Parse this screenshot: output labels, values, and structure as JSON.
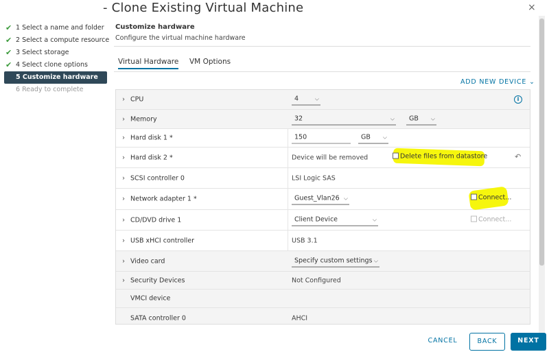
{
  "window": {
    "title": "- Clone Existing Virtual Machine",
    "close_glyph": "×"
  },
  "steps": [
    {
      "label": "1 Select a name and folder",
      "done": true
    },
    {
      "label": "2 Select a compute resource",
      "done": true
    },
    {
      "label": "3 Select storage",
      "done": true
    },
    {
      "label": "4 Select clone options",
      "done": true
    },
    {
      "label": "5 Customize hardware",
      "active": true
    },
    {
      "label": "6 Ready to complete",
      "future": true
    }
  ],
  "header": {
    "title": "Customize hardware",
    "subtitle": "Configure the virtual machine hardware"
  },
  "tabs": [
    {
      "label": "Virtual Hardware",
      "active": true
    },
    {
      "label": "VM Options",
      "active": false
    }
  ],
  "add_device": "ADD NEW DEVICE",
  "hardware": {
    "cpu": {
      "label": "CPU",
      "value": "4"
    },
    "memory": {
      "label": "Memory",
      "value": "32",
      "unit": "GB"
    },
    "hard_disk_1": {
      "label": "Hard disk 1 *",
      "value": "150",
      "unit": "GB"
    },
    "hard_disk_2": {
      "label": "Hard disk 2 *",
      "status": "Device will be removed",
      "checkbox_label": "Delete files from datastore"
    },
    "scsi": {
      "label": "SCSI controller 0",
      "value": "LSI Logic SAS"
    },
    "network": {
      "label": "Network adapter 1 *",
      "value": "Guest_Vlan26",
      "checkbox_label": "Connect..."
    },
    "cd_dvd": {
      "label": "CD/DVD drive 1",
      "value": "Client Device",
      "checkbox_label": "Connect..."
    },
    "usb": {
      "label": "USB xHCI controller",
      "value": "USB 3.1"
    },
    "video": {
      "label": "Video card",
      "value": "Specify custom settings"
    },
    "security": {
      "label": "Security Devices",
      "value": "Not Configured"
    },
    "vmci": {
      "label": "VMCI device"
    },
    "sata": {
      "label": "SATA controller 0",
      "value": "AHCI"
    }
  },
  "colors": {
    "accent": "#0072a3",
    "active_step_bg": "#2f4858",
    "check_green": "#3a9a3a",
    "highlighter": "#f5f500"
  },
  "buttons": {
    "cancel": "CANCEL",
    "back": "BACK",
    "next": "NEXT"
  }
}
